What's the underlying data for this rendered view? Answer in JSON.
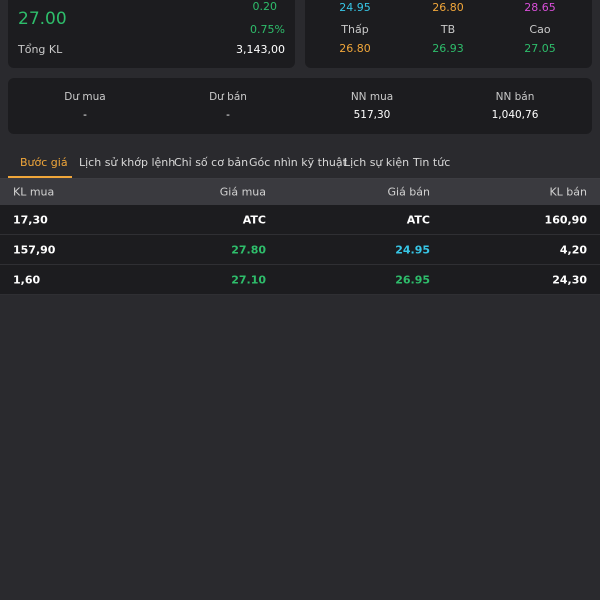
{
  "summary": {
    "price": "27.00",
    "change": "0.20",
    "change_pct": "0.75%",
    "volume_label": "Tổng KL",
    "volume_value": "3,143,00"
  },
  "price_range": {
    "top_values": [
      "24.95",
      "26.80",
      "28.65"
    ],
    "labels": [
      "Thấp",
      "TB",
      "Cao"
    ],
    "values": [
      "26.80",
      "26.93",
      "27.05"
    ]
  },
  "stats": [
    {
      "label": "Dư mua",
      "value": "-"
    },
    {
      "label": "Dư bán",
      "value": "-"
    },
    {
      "label": "NN mua",
      "value": "517,30"
    },
    {
      "label": "NN bán",
      "value": "1,040,76"
    }
  ],
  "tabs": [
    "Bước giá",
    "Lịch sử khớp lệnh",
    "Chỉ số cơ bản",
    "Góc nhìn kỹ thuật",
    "Lịch sự kiện",
    "Tin tức"
  ],
  "active_tab": "Bước giá",
  "table": {
    "headers": [
      "KL mua",
      "Giá mua",
      "Giá bán",
      "KL bán"
    ],
    "rows": [
      [
        "17,30",
        "ATC",
        "ATC",
        "160,90"
      ],
      [
        "157,90",
        "27.80",
        "24.95",
        "4,20"
      ],
      [
        "1,60",
        "27.10",
        "26.95",
        "24,30"
      ]
    ]
  },
  "colors": {
    "up": "#2ebd6b",
    "floor_ceiling_low": "#37c6e6",
    "ref": "#f0a63a",
    "ceiling": "#d94fd9",
    "background": "#2a2a2e",
    "card": "#1c1c1f"
  }
}
